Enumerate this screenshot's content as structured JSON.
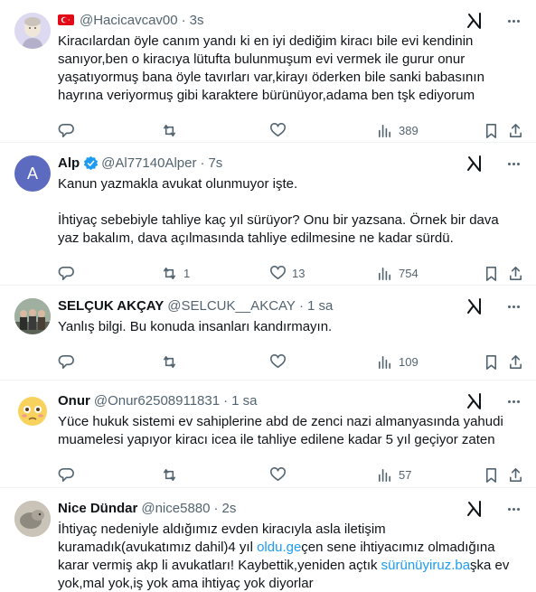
{
  "tweets": [
    {
      "name": "",
      "handle": "@Hacicavcav00",
      "time": "3s",
      "has_flag": true,
      "text": "Kiracılardan öyle canım yandı ki en iyi dediğim kiracı bile evi kendinin sanıyor,ben o kiracıya lütufta bulunmuşum evi vermek ile gurur onur yaşatıyormuş bana öyle tavırları var,kirayı öderken bile sanki babasının hayrına veriyormuş gibi karaktere bürünüyor,adama ben tşk ediyorum",
      "replies": "",
      "reposts": "",
      "likes": "",
      "views": "389"
    },
    {
      "name": "Alp",
      "verified": true,
      "avatar_letter": "A",
      "handle": "@Al77140Alper",
      "time": "7s",
      "text": "Kanun yazmakla avukat olunmuyor işte.\n\nİhtiyaç sebebiyle tahliye kaç yıl sürüyor? Onu bir yazsana. Örnek bir dava yaz bakalım, dava açılmasında tahliye edilmesine ne kadar sürdü.",
      "replies": "",
      "reposts": "1",
      "likes": "13",
      "views": "754"
    },
    {
      "name": "SELÇUK AKÇAY",
      "handle": "@SELCUK__AKCAY",
      "time": "1 sa",
      "text": "Yanlış bilgi. Bu konuda insanları kandırmayın.",
      "replies": "",
      "reposts": "",
      "likes": "",
      "views": "109"
    },
    {
      "name": "Onur",
      "handle": "@Onur62508911831",
      "time": "1 sa",
      "text": "Yüce hukuk sistemi ev sahiplerine abd de zenci nazi almanyasında yahudi muamelesi yapıyor kiracı icea ile tahliye edilene kadar 5 yıl geçiyor zaten",
      "replies": "",
      "reposts": "",
      "likes": "",
      "views": "57"
    },
    {
      "name": "Nice Dündar",
      "handle": "@nice5880",
      "time": "2s",
      "text_pre": "İhtiyaç nedeniyle aldığımız evden kiracıyla asla iletişim kuramadık(avukatımız dahil)4 yıl ",
      "link1": "oldu.ge",
      "text_mid": "çen sene ihtiyacımız olmadığına karar vermiş akp li avukatları! Kaybettik,yeniden açtık ",
      "link2": "sürünüyiruz.ba",
      "text_post": "şka ev yok,mal yok,iş yok ama ihtiyaç yok diyorlar"
    }
  ],
  "colors": {
    "text": "#0f1419",
    "secondary": "#536471",
    "link": "#1d9bf0",
    "verified": "#1d9bf0",
    "divider": "#eff3f4"
  }
}
